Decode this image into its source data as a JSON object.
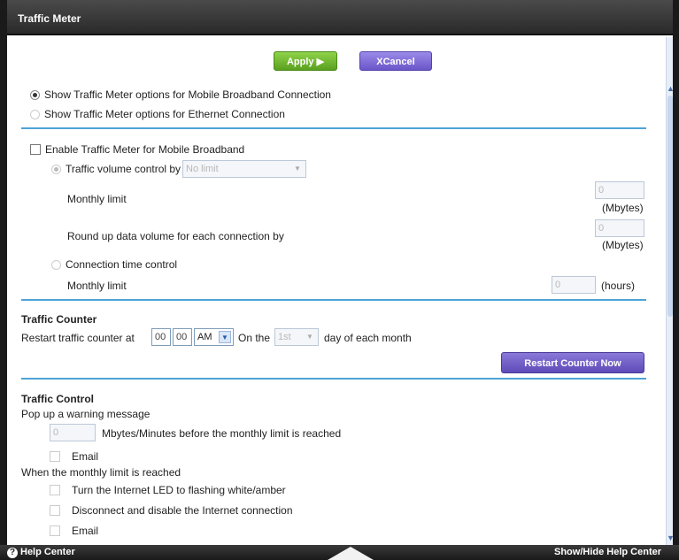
{
  "window": {
    "title": "Traffic Meter"
  },
  "toolbar": {
    "apply_label": "Apply ▶",
    "cancel_label": "XCancel"
  },
  "connection_options": {
    "mobile_label": "Show Traffic Meter options for Mobile Broadband Connection",
    "ethernet_label": "Show Traffic Meter options for Ethernet Connection"
  },
  "meter": {
    "enable_label": "Enable Traffic Meter for Mobile Broadband",
    "volume_label": "Traffic volume control by",
    "volume_select": "No limit",
    "monthly_limit_label": "Monthly limit",
    "monthly_limit_value": "0",
    "mbytes_unit": "(Mbytes)",
    "roundup_label": "Round up data volume for each connection by",
    "roundup_value": "0",
    "time_control_label": "Connection time control",
    "time_limit_label": "Monthly limit",
    "time_limit_value": "0",
    "hours_unit": "(hours)"
  },
  "counter": {
    "heading": "Traffic Counter",
    "restart_label": "Restart traffic counter at",
    "hour": "00",
    "minute": "00",
    "ampm": "AM",
    "on_the_label": "On the",
    "day": "1st",
    "day_suffix": "day of each month",
    "restart_button": "Restart Counter Now"
  },
  "control": {
    "heading": "Traffic Control",
    "popup_label": "Pop up a warning message",
    "warn_value": "0",
    "warn_suffix": "Mbytes/Minutes before the monthly limit is reached",
    "email_label": "Email",
    "reached_label": "When the monthly limit is reached",
    "led_label": "Turn the Internet LED to flashing white/amber",
    "disconnect_label": "Disconnect and disable the Internet connection",
    "email2_label": "Email"
  },
  "footer": {
    "help_label": "Help Center",
    "toggle_label": "Show/Hide Help Center"
  }
}
